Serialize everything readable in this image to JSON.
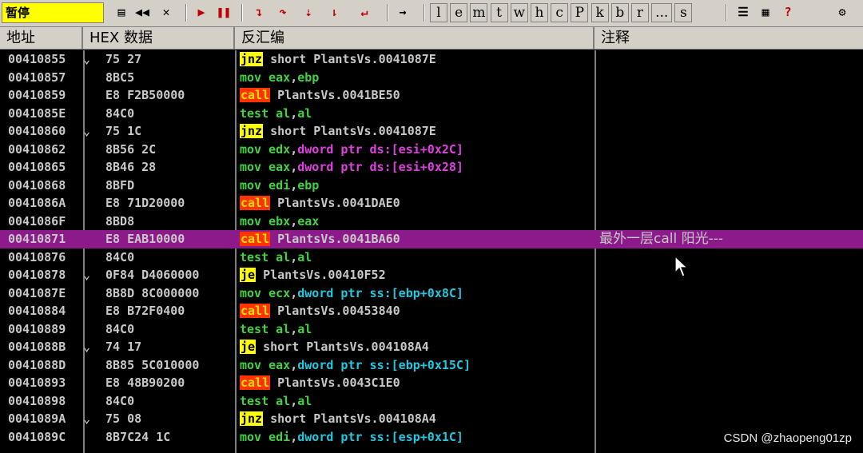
{
  "toolbar": {
    "status": "暂停",
    "buttons": [
      "open-icon",
      "rewind-icon",
      "close-icon",
      "run-icon",
      "pause-icon",
      "step-into-icon",
      "step-over-icon",
      "trace-into-icon",
      "trace-over-icon",
      "execute-till-return-icon",
      "goto-icon"
    ],
    "letters": [
      "l",
      "e",
      "m",
      "t",
      "w",
      "h",
      "c",
      "P",
      "k",
      "b",
      "r",
      "...",
      "s"
    ]
  },
  "header": {
    "addr": "地址",
    "hex": "HEX 数据",
    "disasm": "反汇编",
    "comment": "注释"
  },
  "rows": [
    {
      "addr": "00410855",
      "arrow": "⌄",
      "hex": "75 27",
      "mn": "jnz",
      "kind": "jx",
      "ops": [
        [
          "short PlantsVs.0041087E",
          "op"
        ]
      ],
      "cmt": ""
    },
    {
      "addr": "00410857",
      "arrow": "",
      "hex": "8BC5",
      "mn": "mov",
      "kind": "",
      "ops": [
        [
          "eax",
          "reg"
        ],
        [
          ",",
          "op"
        ],
        [
          "ebp",
          "reg"
        ]
      ],
      "cmt": ""
    },
    {
      "addr": "00410859",
      "arrow": "",
      "hex": "E8 F2B50000",
      "mn": "call",
      "kind": "call",
      "ops": [
        [
          "PlantsVs.0041BE50",
          "op"
        ]
      ],
      "cmt": ""
    },
    {
      "addr": "0041085E",
      "arrow": "",
      "hex": "84C0",
      "mn": "test",
      "kind": "",
      "ops": [
        [
          "al",
          "reg"
        ],
        [
          ",",
          "op"
        ],
        [
          "al",
          "reg"
        ]
      ],
      "cmt": ""
    },
    {
      "addr": "00410860",
      "arrow": "⌄",
      "hex": "75 1C",
      "mn": "jnz",
      "kind": "jx",
      "ops": [
        [
          "short PlantsVs.0041087E",
          "op"
        ]
      ],
      "cmt": ""
    },
    {
      "addr": "00410862",
      "arrow": "",
      "hex": "8B56 2C",
      "mn": "mov",
      "kind": "",
      "ops": [
        [
          "edx",
          "reg"
        ],
        [
          ",",
          "op"
        ],
        [
          "dword ptr ds:[esi+0x2C]",
          "magenta"
        ]
      ],
      "cmt": ""
    },
    {
      "addr": "00410865",
      "arrow": "",
      "hex": "8B46 28",
      "mn": "mov",
      "kind": "",
      "ops": [
        [
          "eax",
          "reg"
        ],
        [
          ",",
          "op"
        ],
        [
          "dword ptr ds:[esi+0x28]",
          "magenta"
        ]
      ],
      "cmt": ""
    },
    {
      "addr": "00410868",
      "arrow": "",
      "hex": "8BFD",
      "mn": "mov",
      "kind": "",
      "ops": [
        [
          "edi",
          "reg"
        ],
        [
          ",",
          "op"
        ],
        [
          "ebp",
          "reg"
        ]
      ],
      "cmt": ""
    },
    {
      "addr": "0041086A",
      "arrow": "",
      "hex": "E8 71D20000",
      "mn": "call",
      "kind": "call",
      "ops": [
        [
          "PlantsVs.0041DAE0",
          "op"
        ]
      ],
      "cmt": ""
    },
    {
      "addr": "0041086F",
      "arrow": "",
      "hex": "8BD8",
      "mn": "mov",
      "kind": "",
      "ops": [
        [
          "ebx",
          "reg"
        ],
        [
          ",",
          "op"
        ],
        [
          "eax",
          "reg"
        ]
      ],
      "cmt": ""
    },
    {
      "addr": "00410871",
      "arrow": "",
      "hex": "E8 EAB10000",
      "mn": "call",
      "kind": "call",
      "ops": [
        [
          "PlantsVs.0041BA60",
          "op"
        ]
      ],
      "cmt": "最外一层call 阳光---",
      "selected": true
    },
    {
      "addr": "00410876",
      "arrow": "",
      "hex": "84C0",
      "mn": "test",
      "kind": "",
      "ops": [
        [
          "al",
          "reg"
        ],
        [
          ",",
          "op"
        ],
        [
          "al",
          "reg"
        ]
      ],
      "cmt": ""
    },
    {
      "addr": "00410878",
      "arrow": "⌄",
      "hex": "0F84 D4060000",
      "mn": "je",
      "kind": "jx",
      "ops": [
        [
          "PlantsVs.00410F52",
          "op"
        ]
      ],
      "cmt": ""
    },
    {
      "addr": "0041087E",
      "arrow": "",
      "hex": "8B8D 8C000000",
      "mn": "mov",
      "kind": "",
      "ops": [
        [
          "ecx",
          "reg"
        ],
        [
          ",",
          "op"
        ],
        [
          "dword ptr ss:[ebp+0x8C]",
          "cyan"
        ]
      ],
      "cmt": ""
    },
    {
      "addr": "00410884",
      "arrow": "",
      "hex": "E8 B72F0400",
      "mn": "call",
      "kind": "call",
      "ops": [
        [
          "PlantsVs.00453840",
          "op"
        ]
      ],
      "cmt": ""
    },
    {
      "addr": "00410889",
      "arrow": "",
      "hex": "84C0",
      "mn": "test",
      "kind": "",
      "ops": [
        [
          "al",
          "reg"
        ],
        [
          ",",
          "op"
        ],
        [
          "al",
          "reg"
        ]
      ],
      "cmt": ""
    },
    {
      "addr": "0041088B",
      "arrow": "⌄",
      "hex": "74 17",
      "mn": "je",
      "kind": "jx",
      "ops": [
        [
          "short PlantsVs.004108A4",
          "op"
        ]
      ],
      "cmt": ""
    },
    {
      "addr": "0041088D",
      "arrow": "",
      "hex": "8B85 5C010000",
      "mn": "mov",
      "kind": "",
      "ops": [
        [
          "eax",
          "reg"
        ],
        [
          ",",
          "op"
        ],
        [
          "dword ptr ss:[ebp+0x15C]",
          "cyan"
        ]
      ],
      "cmt": ""
    },
    {
      "addr": "00410893",
      "arrow": "",
      "hex": "E8 48B90200",
      "mn": "call",
      "kind": "call",
      "ops": [
        [
          "PlantsVs.0043C1E0",
          "op"
        ]
      ],
      "cmt": ""
    },
    {
      "addr": "00410898",
      "arrow": "",
      "hex": "84C0",
      "mn": "test",
      "kind": "",
      "ops": [
        [
          "al",
          "reg"
        ],
        [
          ",",
          "op"
        ],
        [
          "al",
          "reg"
        ]
      ],
      "cmt": ""
    },
    {
      "addr": "0041089A",
      "arrow": "⌄",
      "hex": "75 08",
      "mn": "jnz",
      "kind": "jx",
      "ops": [
        [
          "short PlantsVs.004108A4",
          "op"
        ]
      ],
      "cmt": ""
    },
    {
      "addr": "0041089C",
      "arrow": "",
      "hex": "8B7C24 1C",
      "mn": "mov",
      "kind": "",
      "ops": [
        [
          "edi",
          "reg"
        ],
        [
          ",",
          "op"
        ],
        [
          "dword ptr ss:[esp+0x1C]",
          "cyan"
        ]
      ],
      "cmt": ""
    }
  ],
  "watermark": "CSDN @zhaopeng01zp"
}
